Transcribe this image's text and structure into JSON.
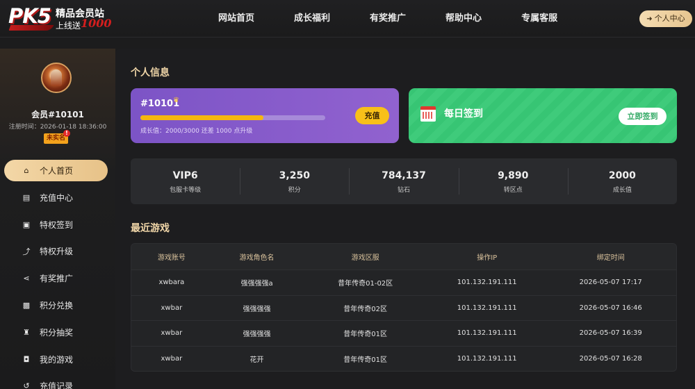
{
  "header": {
    "logo": {
      "brand": "PK5",
      "title": "精品会员站",
      "subtitle": "上线送",
      "number": "1000"
    },
    "nav": [
      "网站首页",
      "成长福利",
      "有奖推广",
      "帮助中心",
      "专属客服"
    ],
    "user_center_label": "个人中心"
  },
  "sidebar": {
    "member_name": "会员#10101",
    "register_time": "注册时间：2026-01-18 18:36:00",
    "badge": "未实名",
    "badge_alert": "!",
    "items": [
      {
        "label": "个人首页",
        "icon": "home-icon",
        "active": true
      },
      {
        "label": "充值中心",
        "icon": "coins-icon",
        "active": false
      },
      {
        "label": "特权签到",
        "icon": "calendar-check-icon",
        "active": false
      },
      {
        "label": "特权升级",
        "icon": "arrow-up-icon",
        "active": false
      },
      {
        "label": "有奖推广",
        "icon": "share-icon",
        "active": false
      },
      {
        "label": "积分兑换",
        "icon": "gift-icon",
        "active": false
      },
      {
        "label": "积分抽奖",
        "icon": "trophy-icon",
        "active": false
      },
      {
        "label": "我的游戏",
        "icon": "gamepad-icon",
        "active": false
      },
      {
        "label": "充值记录",
        "icon": "history-icon",
        "active": false
      }
    ]
  },
  "main": {
    "profile_title": "个人信息",
    "vip_card": {
      "id": "#10101",
      "progress_fraction": 0.667,
      "progress_text": "成长值：2000/3000 还差 1000 点升级",
      "recharge_label": "充值"
    },
    "sign_card": {
      "title": "每日签到",
      "button_label": "立即签到"
    },
    "stats": [
      {
        "value": "VIP6",
        "label": "包服卡等级"
      },
      {
        "value": "3,250",
        "label": "积分"
      },
      {
        "value": "784,137",
        "label": "钻石"
      },
      {
        "value": "9,890",
        "label": "转区点"
      },
      {
        "value": "2000",
        "label": "成长值"
      }
    ],
    "recent_title": "最近游戏",
    "table": {
      "headers": [
        "游戏账号",
        "游戏角色名",
        "游戏区服",
        "操作IP",
        "绑定时间"
      ],
      "rows": [
        [
          "xwbara",
          "强强强强a",
          "昔年传奇01-02区",
          "101.132.191.111",
          "2026-05-07 17:17"
        ],
        [
          "xwbar",
          "强强强强",
          "昔年传奇02区",
          "101.132.191.111",
          "2026-05-07 16:46"
        ],
        [
          "xwbar",
          "强强强强",
          "昔年传奇01区",
          "101.132.191.111",
          "2026-05-07 16:39"
        ],
        [
          "xwbar",
          "花开",
          "昔年传奇01区",
          "101.132.191.111",
          "2026-05-07 16:28"
        ]
      ]
    }
  },
  "colors": {
    "accent_gold": "#e7c288",
    "vip_purple": "#8a5ccb",
    "sign_green": "#3fcb7b",
    "progress_yellow": "#f5b70f"
  }
}
